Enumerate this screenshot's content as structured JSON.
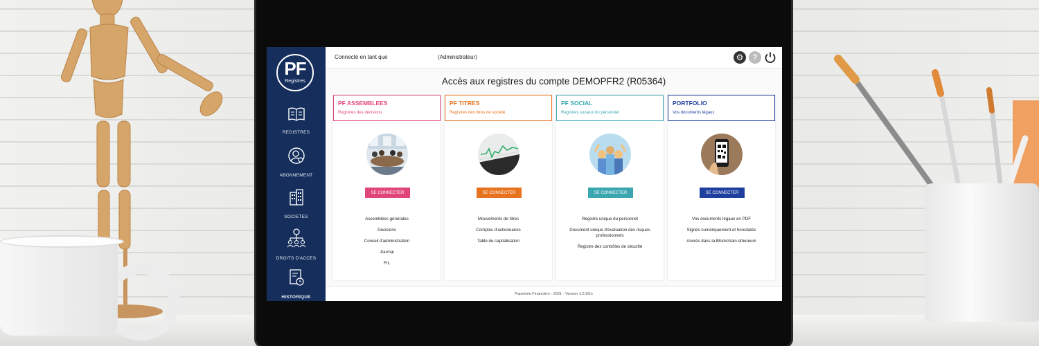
{
  "topbar": {
    "connected_label": "Connecté en tant que",
    "role": "(Administrateur)"
  },
  "logo": {
    "main": "PF",
    "sub": "Registres"
  },
  "sidebar": {
    "items": [
      {
        "label": "REGISTRES",
        "icon": "book-icon"
      },
      {
        "label": "ABONNEMENT",
        "icon": "user-settings-icon"
      },
      {
        "label": "SOCIETES",
        "icon": "building-icon"
      },
      {
        "label": "DROITS D'ACCES",
        "icon": "org-chart-icon"
      },
      {
        "label": "HISTORIQUE",
        "icon": "history-icon"
      }
    ]
  },
  "page_title": "Accès aux registres du compte DEMOPFR2 (R05364)",
  "cards": [
    {
      "title": "PF ASSEMBLEES",
      "subtitle": "Registres des décisions",
      "accent": "#e0457b",
      "button": "SE CONNECTER",
      "items": [
        "Assemblées générales",
        "Décisions",
        "Conseil d'administration",
        "Journal",
        "FIL"
      ]
    },
    {
      "title": "PF TITRES",
      "subtitle": "Registres des titres de société",
      "accent": "#e8731f",
      "button": "SE CONNECTER",
      "items": [
        "Mouvements de titres",
        "Comptes d'actionnaires",
        "Table de capitalisation"
      ]
    },
    {
      "title": "PF SOCIAL",
      "subtitle": "Registres sociaux du personnel",
      "accent": "#3aa6b0",
      "button": "SE CONNECTER",
      "items": [
        "Registre unique du personnel",
        "Document unique d'évaluation des risques professionnels",
        "Registre des contrôles de sécurité"
      ]
    },
    {
      "title": "PORTFOLIO",
      "subtitle": "Vos documents légaux",
      "accent": "#1e3f9e",
      "button": "SE CONNECTER",
      "items": [
        "Vos documents légaux en PDF",
        "Signés numériquement et horodatés",
        "Ancrés dans la Blockchain ethereum"
      ]
    }
  ],
  "footer": "Papeterie Financière - 2021 - Version 1.0.36m"
}
